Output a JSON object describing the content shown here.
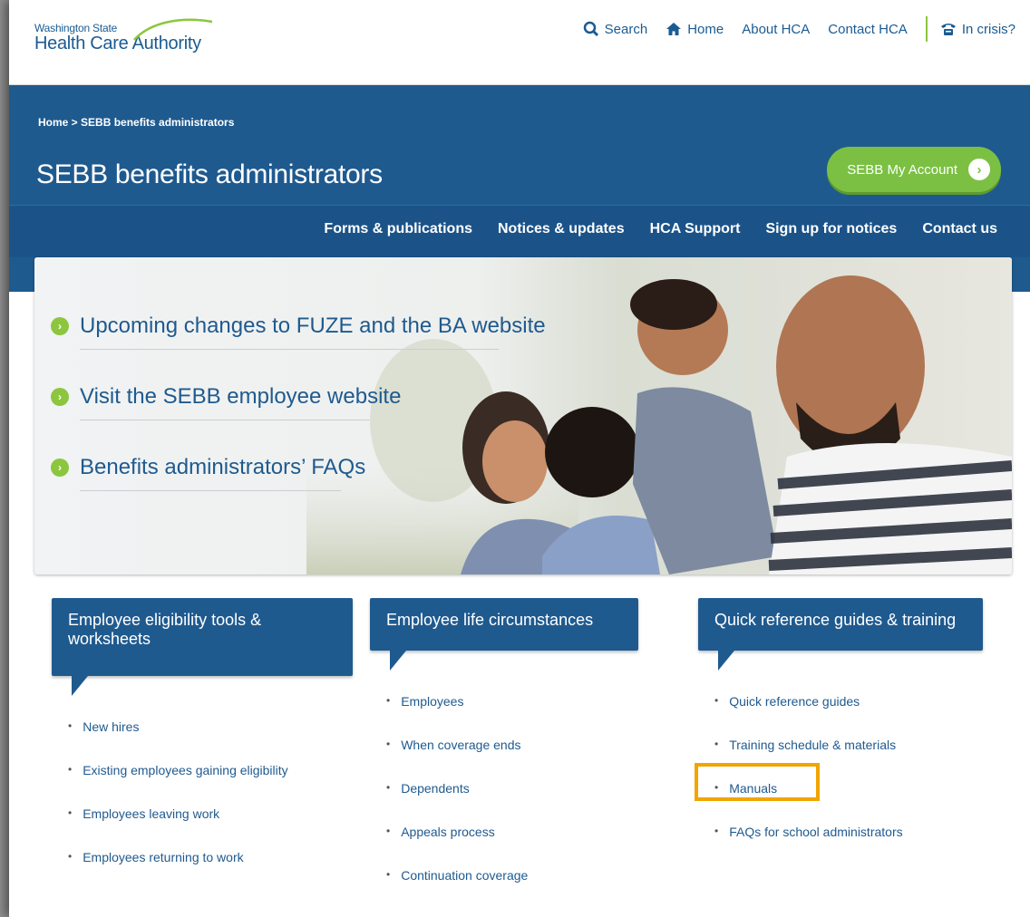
{
  "logo": {
    "line1": "Washington State",
    "line2": "Health Care Authority"
  },
  "util_nav": {
    "search": "Search",
    "home": "Home",
    "about": "About HCA",
    "contact": "Contact HCA",
    "crisis": "In crisis?"
  },
  "breadcrumb": "Home > SEBB benefits administrators",
  "page_title": "SEBB benefits administrators",
  "account_button": "SEBB My Account",
  "main_nav": [
    "Forms & publications",
    "Notices & updates",
    "HCA Support",
    "Sign up for notices",
    "Contact us"
  ],
  "promos": [
    "Upcoming changes to FUZE and the BA website",
    "Visit the SEBB employee website",
    "Benefits administrators’ FAQs"
  ],
  "columns": [
    {
      "title_line1": "Employee eligibility tools &",
      "title_line2": "worksheets",
      "items": [
        "New hires",
        "Existing employees gaining eligibility",
        "Employees leaving work",
        "Employees returning to work"
      ]
    },
    {
      "title_line1": "Employee life circumstances",
      "title_line2": "",
      "items": [
        "Employees",
        "When coverage ends",
        "Dependents",
        "Appeals process",
        "Continuation coverage"
      ]
    },
    {
      "title_line1": "Quick reference guides & training",
      "title_line2": "",
      "items": [
        "Quick reference guides",
        "Training schedule & materials",
        "Manuals",
        "FAQs for school administrators"
      ]
    }
  ],
  "colors": {
    "brand_blue": "#1f5a8f",
    "accent_green": "#8cc63f",
    "highlight": "#f0a500"
  }
}
